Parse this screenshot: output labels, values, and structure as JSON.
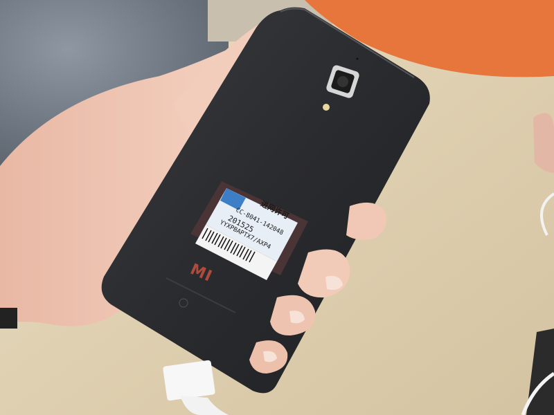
{
  "scene": {
    "description_label": "",
    "colors": {
      "table": "#dccfb3",
      "background_orange": "#e8743a",
      "phone_body": "#2b2c2f",
      "skin": "#f0cbb8",
      "logo_red": "#b04a3a"
    }
  },
  "phone": {
    "brand_logo": "MI",
    "sticker": {
      "title": "进网许可",
      "line1": "CC-8041-142048",
      "line2": "201525",
      "line3": "YYXPBAPTX7/AXP4"
    }
  }
}
